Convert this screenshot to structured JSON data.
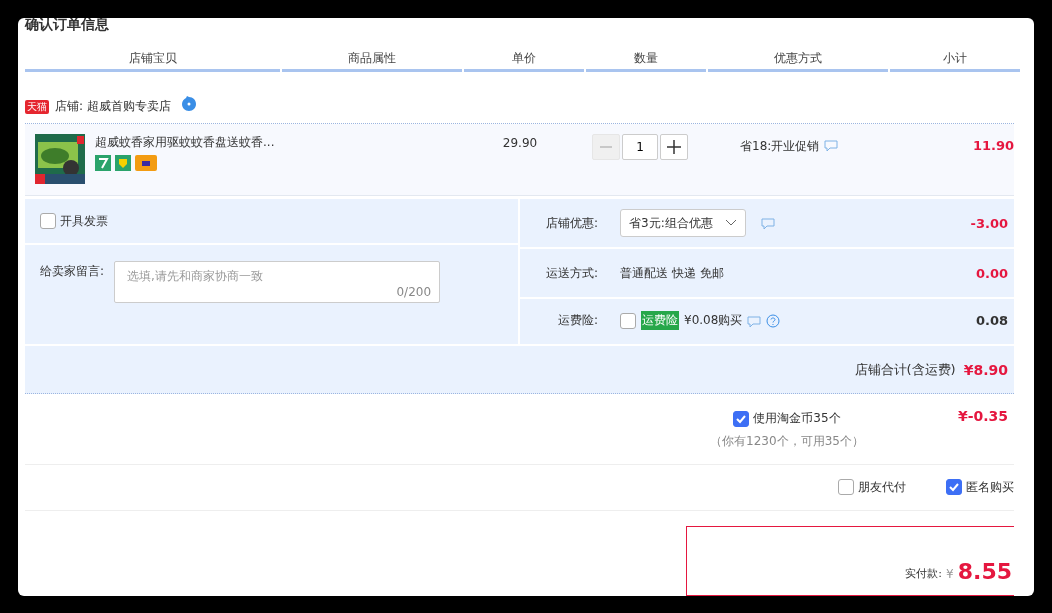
{
  "title": "确认订单信息",
  "columns": [
    "店铺宝贝",
    "商品属性",
    "单价",
    "数量",
    "优惠方式",
    "小计"
  ],
  "shop": {
    "badge": "天猫",
    "name": "店铺: 超威首购专卖店"
  },
  "item": {
    "title": "超威蚊香家用驱蚊蚊香盘送蚊香...",
    "price": "29.90",
    "quantity": "1",
    "promo": "省18:开业促销",
    "subtotal": "11.90"
  },
  "invoice": {
    "label": "开具发票",
    "checked": false
  },
  "message": {
    "label": "给卖家留言:",
    "placeholder": "选填,请先和商家协商一致",
    "counter": "0/200"
  },
  "discount": {
    "label": "店铺优惠:",
    "value": "省3元:组合优惠",
    "amount": "-3.00"
  },
  "shipping": {
    "label": "运送方式:",
    "value": "普通配送 快递 免邮",
    "amount": "0.00"
  },
  "insurance": {
    "label": "运费险:",
    "checked": false,
    "tag": "运费险",
    "text": "¥0.08购买",
    "amount": "0.08"
  },
  "shop_total": {
    "label": "店铺合计(含运费)",
    "amount": "¥8.90"
  },
  "coins": {
    "label": "使用淘金币35个",
    "checked": true,
    "note": "（你有1230个，可用35个）",
    "amount": "¥-0.35"
  },
  "options": [
    {
      "label": "朋友代付",
      "checked": false
    },
    {
      "label": "匿名购买",
      "checked": true
    }
  ],
  "payment": {
    "label": "实付款:",
    "currency": "¥",
    "amount": "8.55"
  }
}
